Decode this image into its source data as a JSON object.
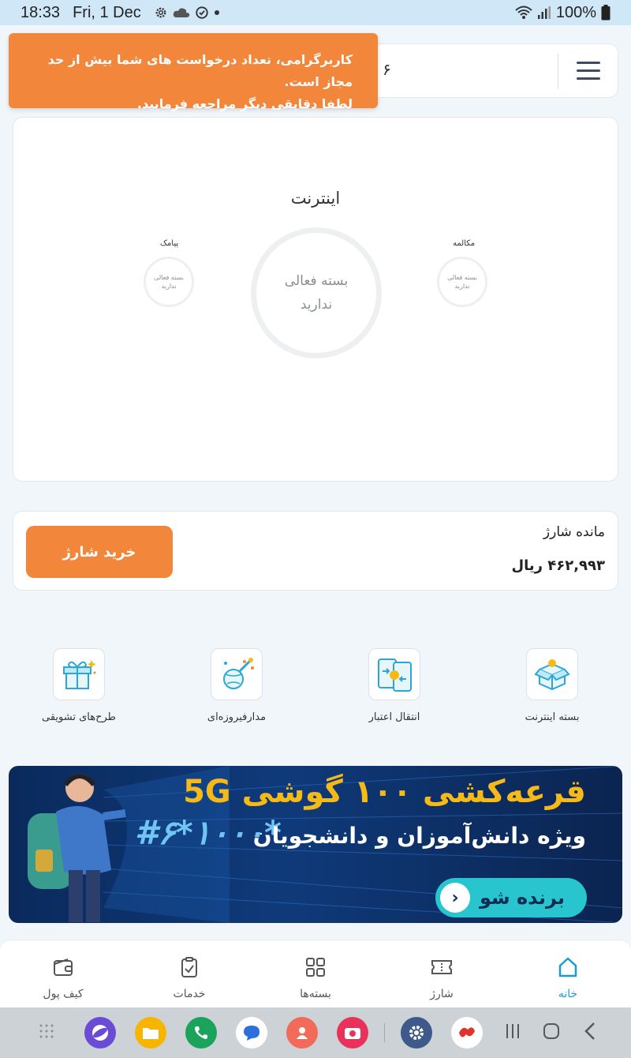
{
  "status_bar": {
    "time": "18:33",
    "date": "Fri, 1 Dec",
    "battery": "100%"
  },
  "toast": {
    "line1": "کاربرگرامی، تعداد درخواست های شما بیش از حد مجاز است.",
    "line2": "لطفا دقایقی دیگر مراجعه فرمایید."
  },
  "top_bar": {
    "partial_number": "۶"
  },
  "packages": {
    "title": "اینترنت",
    "internet_status_line1": "بسته فعالی",
    "internet_status_line2": "ندارید",
    "sms_label": "پیامک",
    "sms_status_line1": "بسته فعالی",
    "sms_status_line2": "ندارید",
    "call_label": "مکالمه",
    "call_status_line1": "بسته فعالی",
    "call_status_line2": "ندارید"
  },
  "charge": {
    "label": "مانده شارژ",
    "amount": "۴۶۲,۹۹۳ ریال",
    "buy_button": "خرید شارژ"
  },
  "services": [
    {
      "label": "بسته اینترنت",
      "icon": "internet-package-icon"
    },
    {
      "label": "انتقال اعتبار",
      "icon": "credit-transfer-icon"
    },
    {
      "label": "مدارفیروزه‌ای",
      "icon": "turquoise-orbit-icon"
    },
    {
      "label": "طرح‌های تشویقی",
      "icon": "gift-icon"
    }
  ],
  "banner": {
    "headline": "قرعه‌کشی ۱۰۰ گوشی 5G",
    "subline": "ویژه دانش‌آموزان و دانشجویان",
    "cta": "برنده شو",
    "code": "#۶*۱۰۰۰*"
  },
  "bottom_nav": [
    {
      "label": "خانه",
      "icon": "home-icon",
      "active": true
    },
    {
      "label": "شارژ",
      "icon": "ticket-icon",
      "active": false
    },
    {
      "label": "بسته‌ها",
      "icon": "grid-icon",
      "active": false
    },
    {
      "label": "خدمات",
      "icon": "clipboard-check-icon",
      "active": false
    },
    {
      "label": "کیف پول",
      "icon": "wallet-icon",
      "active": false
    }
  ],
  "colors": {
    "accent_orange": "#f2863a",
    "active_blue": "#1a9bd6",
    "banner_yellow": "#f5b918",
    "banner_cyan": "#28c5cf"
  }
}
